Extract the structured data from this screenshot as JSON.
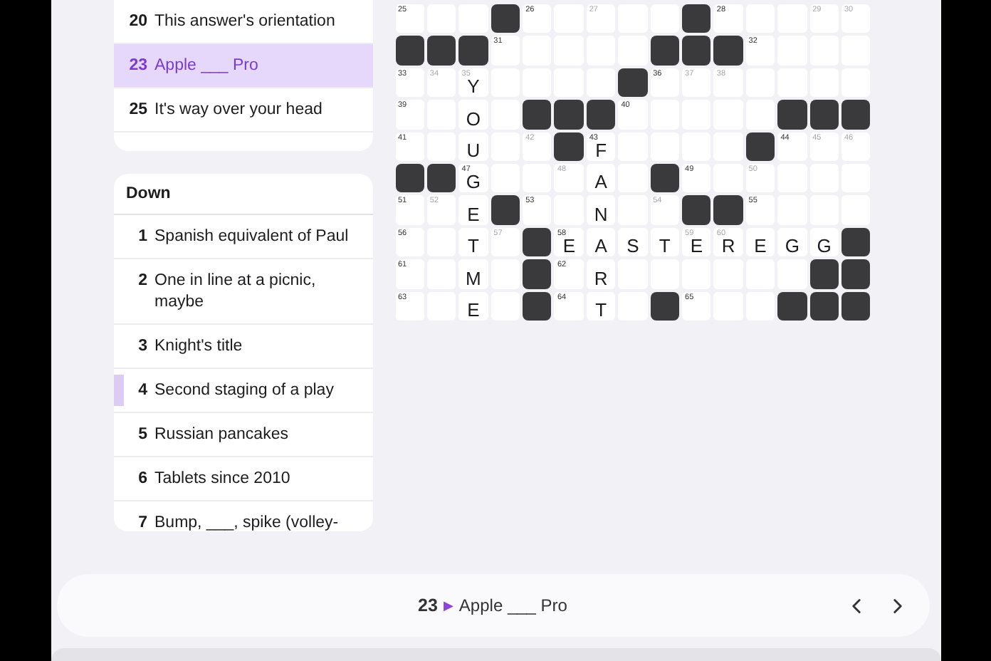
{
  "across": {
    "items": [
      {
        "number": "20",
        "clue": "This answer's orientation",
        "selected": false
      },
      {
        "number": "23",
        "clue": "Apple ___ Pro",
        "selected": true
      },
      {
        "number": "25",
        "clue": "It's way over your head",
        "selected": false
      }
    ]
  },
  "down": {
    "title": "Down",
    "items": [
      {
        "number": "1",
        "clue": "Spanish equivalent of Paul",
        "marked": false
      },
      {
        "number": "2",
        "clue": "One in line at a picnic, maybe",
        "marked": false
      },
      {
        "number": "3",
        "clue": "Knight's title",
        "marked": false
      },
      {
        "number": "4",
        "clue": "Second staging of a play",
        "marked": true
      },
      {
        "number": "5",
        "clue": "Russian pancakes",
        "marked": false
      },
      {
        "number": "6",
        "clue": "Tablets since 2010",
        "marked": false
      },
      {
        "number": "7",
        "clue": "Bump, ___, spike (volley-",
        "marked": false
      }
    ]
  },
  "grid": {
    "rows": [
      [
        {
          "kind": "open",
          "number": "25",
          "faint": false
        },
        {
          "kind": "open"
        },
        {
          "kind": "open"
        },
        {
          "kind": "block"
        },
        {
          "kind": "open",
          "number": "26",
          "faint": false
        },
        {
          "kind": "open"
        },
        {
          "kind": "open",
          "number": "27",
          "faint": true
        },
        {
          "kind": "open"
        },
        {
          "kind": "open"
        },
        {
          "kind": "block"
        },
        {
          "kind": "open",
          "number": "28",
          "faint": false
        },
        {
          "kind": "open"
        },
        {
          "kind": "open"
        },
        {
          "kind": "open",
          "number": "29",
          "faint": true
        },
        {
          "kind": "open",
          "number": "30",
          "faint": true
        }
      ],
      [
        {
          "kind": "block"
        },
        {
          "kind": "block"
        },
        {
          "kind": "block"
        },
        {
          "kind": "open",
          "number": "31",
          "faint": false
        },
        {
          "kind": "open"
        },
        {
          "kind": "open"
        },
        {
          "kind": "open"
        },
        {
          "kind": "open"
        },
        {
          "kind": "block"
        },
        {
          "kind": "block"
        },
        {
          "kind": "block"
        },
        {
          "kind": "open",
          "number": "32",
          "faint": false
        },
        {
          "kind": "open"
        },
        {
          "kind": "open"
        },
        {
          "kind": "open"
        }
      ],
      [
        {
          "kind": "open",
          "number": "33",
          "faint": false
        },
        {
          "kind": "open",
          "number": "34",
          "faint": true
        },
        {
          "kind": "open",
          "number": "35",
          "faint": true,
          "letter": "Y"
        },
        {
          "kind": "open"
        },
        {
          "kind": "open"
        },
        {
          "kind": "open"
        },
        {
          "kind": "open"
        },
        {
          "kind": "block"
        },
        {
          "kind": "open",
          "number": "36",
          "faint": false
        },
        {
          "kind": "open",
          "number": "37",
          "faint": true
        },
        {
          "kind": "open",
          "number": "38",
          "faint": true
        },
        {
          "kind": "open"
        },
        {
          "kind": "open"
        },
        {
          "kind": "open"
        },
        {
          "kind": "open"
        }
      ],
      [
        {
          "kind": "open",
          "number": "39",
          "faint": false
        },
        {
          "kind": "open"
        },
        {
          "kind": "open",
          "letter": "O"
        },
        {
          "kind": "open"
        },
        {
          "kind": "block"
        },
        {
          "kind": "block"
        },
        {
          "kind": "block"
        },
        {
          "kind": "open",
          "number": "40",
          "faint": false
        },
        {
          "kind": "open"
        },
        {
          "kind": "open"
        },
        {
          "kind": "open"
        },
        {
          "kind": "open"
        },
        {
          "kind": "block"
        },
        {
          "kind": "block"
        },
        {
          "kind": "block"
        }
      ],
      [
        {
          "kind": "open",
          "number": "41",
          "faint": false
        },
        {
          "kind": "open"
        },
        {
          "kind": "open",
          "letter": "U"
        },
        {
          "kind": "open"
        },
        {
          "kind": "open",
          "number": "42",
          "faint": true
        },
        {
          "kind": "block"
        },
        {
          "kind": "open",
          "number": "43",
          "faint": false,
          "letter": "F"
        },
        {
          "kind": "open"
        },
        {
          "kind": "open"
        },
        {
          "kind": "open"
        },
        {
          "kind": "open"
        },
        {
          "kind": "block"
        },
        {
          "kind": "open",
          "number": "44",
          "faint": false
        },
        {
          "kind": "open",
          "number": "45",
          "faint": true
        },
        {
          "kind": "open",
          "number": "46",
          "faint": true
        }
      ],
      [
        {
          "kind": "block"
        },
        {
          "kind": "block"
        },
        {
          "kind": "open",
          "number": "47",
          "faint": false,
          "letter": "G"
        },
        {
          "kind": "open"
        },
        {
          "kind": "open"
        },
        {
          "kind": "open",
          "number": "48",
          "faint": true
        },
        {
          "kind": "open",
          "letter": "A"
        },
        {
          "kind": "open"
        },
        {
          "kind": "block"
        },
        {
          "kind": "open",
          "number": "49",
          "faint": false
        },
        {
          "kind": "open"
        },
        {
          "kind": "open",
          "number": "50",
          "faint": true
        },
        {
          "kind": "open"
        },
        {
          "kind": "open"
        },
        {
          "kind": "open"
        }
      ],
      [
        {
          "kind": "open",
          "number": "51",
          "faint": false
        },
        {
          "kind": "open",
          "number": "52",
          "faint": true
        },
        {
          "kind": "open",
          "letter": "E"
        },
        {
          "kind": "block"
        },
        {
          "kind": "open",
          "number": "53",
          "faint": false
        },
        {
          "kind": "open"
        },
        {
          "kind": "open",
          "letter": "N"
        },
        {
          "kind": "open"
        },
        {
          "kind": "open",
          "number": "54",
          "faint": true
        },
        {
          "kind": "block"
        },
        {
          "kind": "block"
        },
        {
          "kind": "open",
          "number": "55",
          "faint": false
        },
        {
          "kind": "open"
        },
        {
          "kind": "open"
        },
        {
          "kind": "open"
        }
      ],
      [
        {
          "kind": "open",
          "number": "56",
          "faint": false
        },
        {
          "kind": "open"
        },
        {
          "kind": "open",
          "letter": "T"
        },
        {
          "kind": "open",
          "number": "57",
          "faint": true
        },
        {
          "kind": "block"
        },
        {
          "kind": "open",
          "number": "58",
          "faint": false,
          "letter": "E"
        },
        {
          "kind": "open",
          "letter": "A"
        },
        {
          "kind": "open",
          "letter": "S"
        },
        {
          "kind": "open",
          "letter": "T"
        },
        {
          "kind": "open",
          "number": "59",
          "faint": true,
          "letter": "E"
        },
        {
          "kind": "open",
          "number": "60",
          "faint": true,
          "letter": "R"
        },
        {
          "kind": "open",
          "letter": "E"
        },
        {
          "kind": "open",
          "letter": "G"
        },
        {
          "kind": "open",
          "letter": "G"
        },
        {
          "kind": "block"
        }
      ],
      [
        {
          "kind": "open",
          "number": "61",
          "faint": false
        },
        {
          "kind": "open"
        },
        {
          "kind": "open",
          "letter": "M"
        },
        {
          "kind": "open"
        },
        {
          "kind": "block"
        },
        {
          "kind": "open",
          "number": "62",
          "faint": false
        },
        {
          "kind": "open",
          "letter": "R"
        },
        {
          "kind": "open"
        },
        {
          "kind": "open"
        },
        {
          "kind": "open"
        },
        {
          "kind": "open"
        },
        {
          "kind": "open"
        },
        {
          "kind": "open"
        },
        {
          "kind": "block"
        },
        {
          "kind": "block"
        }
      ],
      [
        {
          "kind": "open",
          "number": "63",
          "faint": false
        },
        {
          "kind": "open"
        },
        {
          "kind": "open",
          "letter": "E"
        },
        {
          "kind": "open"
        },
        {
          "kind": "block"
        },
        {
          "kind": "open",
          "number": "64",
          "faint": false
        },
        {
          "kind": "open",
          "letter": "T"
        },
        {
          "kind": "open"
        },
        {
          "kind": "block"
        },
        {
          "kind": "open",
          "number": "65",
          "faint": false
        },
        {
          "kind": "open"
        },
        {
          "kind": "open"
        },
        {
          "kind": "block"
        },
        {
          "kind": "block"
        },
        {
          "kind": "block"
        }
      ]
    ]
  },
  "clue_bar": {
    "number": "23",
    "arrow": "▶",
    "clue": "Apple ___ Pro"
  }
}
